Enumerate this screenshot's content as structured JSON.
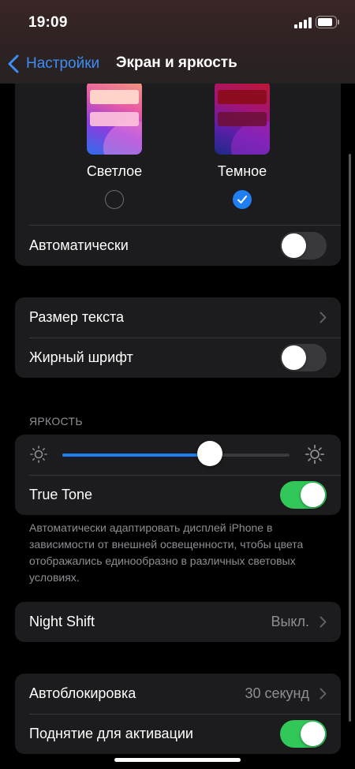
{
  "status_bar": {
    "time": "19:09"
  },
  "nav": {
    "back_label": "Настройки",
    "title": "Экран и яркость"
  },
  "appearance": {
    "light_label": "Светлое",
    "dark_label": "Темное",
    "selected": "dark",
    "auto_label": "Автоматически",
    "auto_on": false
  },
  "text_group": {
    "text_size_label": "Размер текста",
    "bold_label": "Жирный шрифт",
    "bold_on": false
  },
  "brightness": {
    "header": "ЯРКОСТЬ",
    "level_fraction": 0.65,
    "true_tone_label": "True Tone",
    "true_tone_on": true,
    "footnote": "Автоматически адаптировать дисплей iPhone в зависимости от внешней освещенности, чтобы цвета отображались единообразно в различных световых условиях."
  },
  "night_shift": {
    "label": "Night Shift",
    "value": "Выкл."
  },
  "lock_group": {
    "auto_lock_label": "Автоблокировка",
    "auto_lock_value": "30 секунд",
    "raise_to_wake_label": "Поднятие для активации",
    "raise_to_wake_on": true
  },
  "colors": {
    "accent": "#1f7ff2",
    "link": "#3d8df5",
    "toggle_on": "#32c759",
    "card": "#1c1c1e"
  }
}
